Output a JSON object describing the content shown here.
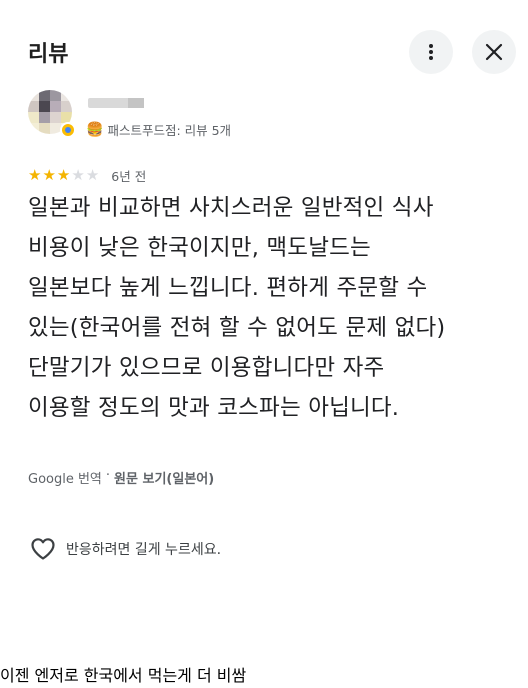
{
  "header": {
    "title": "리뷰",
    "more_icon": "more-vert-icon",
    "close_icon": "close-icon"
  },
  "reviewer": {
    "meta": "패스트푸드점: 리뷰 5개",
    "category_icon": "burger-icon",
    "badge_icon": "local-guide-badge-icon"
  },
  "review": {
    "rating": 3,
    "max_rating": 5,
    "time": "6년 전",
    "lines": [
      "일본과 비교하면 사치스러운 일반적인 식사",
      "비용이 낮은 한국이지만, 맥도날드는",
      "일본보다 높게 느낍니다. 편하게 주문할 수",
      "있는(한국어를 전혀 할 수 없어도 문제 없다)",
      "단말기가 있으므로 이용합니다만 자주",
      "이용할 정도의 맛과 코스파는 아닙니다."
    ],
    "translation_source": "Google 번역",
    "translation_sep": "·",
    "view_original": "원문 보기(일본어)"
  },
  "reaction": {
    "icon": "heart-outline-icon",
    "label": "반응하려면 길게 누르세요."
  },
  "caption": "이젠 엔저로 한국에서 먹는게 더 비쌈",
  "colors": {
    "star_on": "#f4b400",
    "star_off": "#dadce0",
    "text": "#202124",
    "secondary": "#5f6368"
  }
}
